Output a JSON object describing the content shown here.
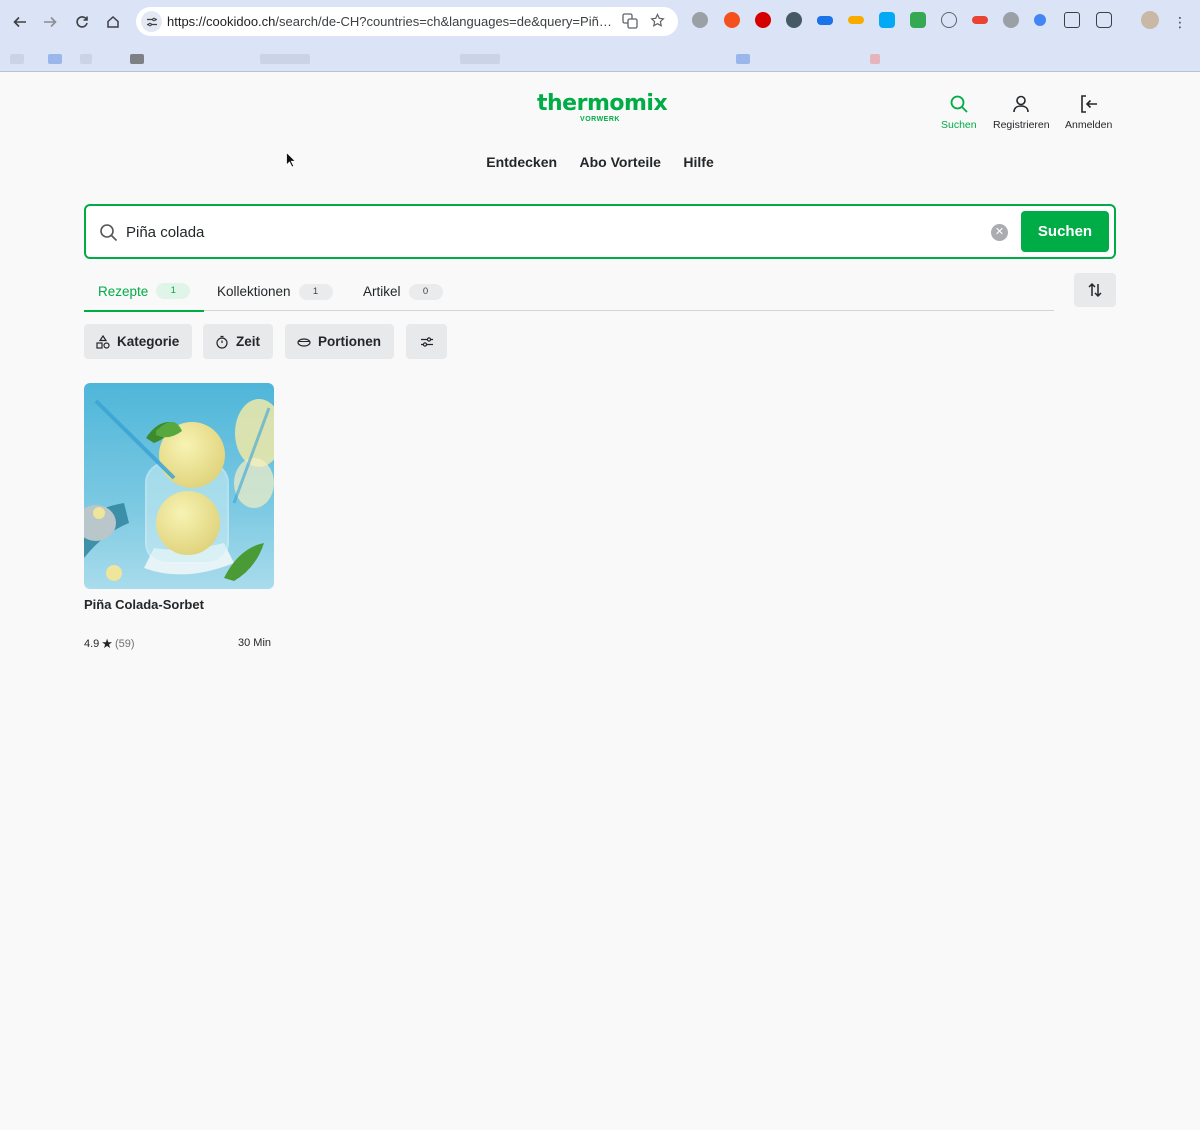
{
  "browser": {
    "url_domain": "https://cookidoo.ch",
    "url_path": "/search/de-CH?countries=ch&languages=de&query=Piña..."
  },
  "header": {
    "logo": "thermomix",
    "logo_sub": "VORWERK",
    "actions": [
      {
        "label": "Suchen",
        "icon": "search-icon",
        "active": true
      },
      {
        "label": "Registrieren",
        "icon": "user-icon"
      },
      {
        "label": "Anmelden",
        "icon": "login-icon"
      }
    ],
    "nav": [
      "Entdecken",
      "Abo Vorteile",
      "Hilfe"
    ]
  },
  "search": {
    "value": "Piña colada",
    "button": "Suchen"
  },
  "tabs": [
    {
      "label": "Rezepte",
      "count": "1",
      "active": true
    },
    {
      "label": "Kollektionen",
      "count": "1"
    },
    {
      "label": "Artikel",
      "count": "0"
    }
  ],
  "filters": [
    {
      "label": "Kategorie",
      "icon": "category-icon"
    },
    {
      "label": "Zeit",
      "icon": "timer-icon"
    },
    {
      "label": "Portionen",
      "icon": "portion-icon"
    },
    {
      "label": "",
      "icon": "sliders-icon"
    }
  ],
  "results": [
    {
      "title": "Piña Colada-Sorbet",
      "rating": "4.9",
      "reviews": "(59)",
      "time": "30 Min"
    }
  ],
  "colors": {
    "brand_green": "#00ac46",
    "text": "#23272a",
    "background": "#f9f9f9"
  }
}
